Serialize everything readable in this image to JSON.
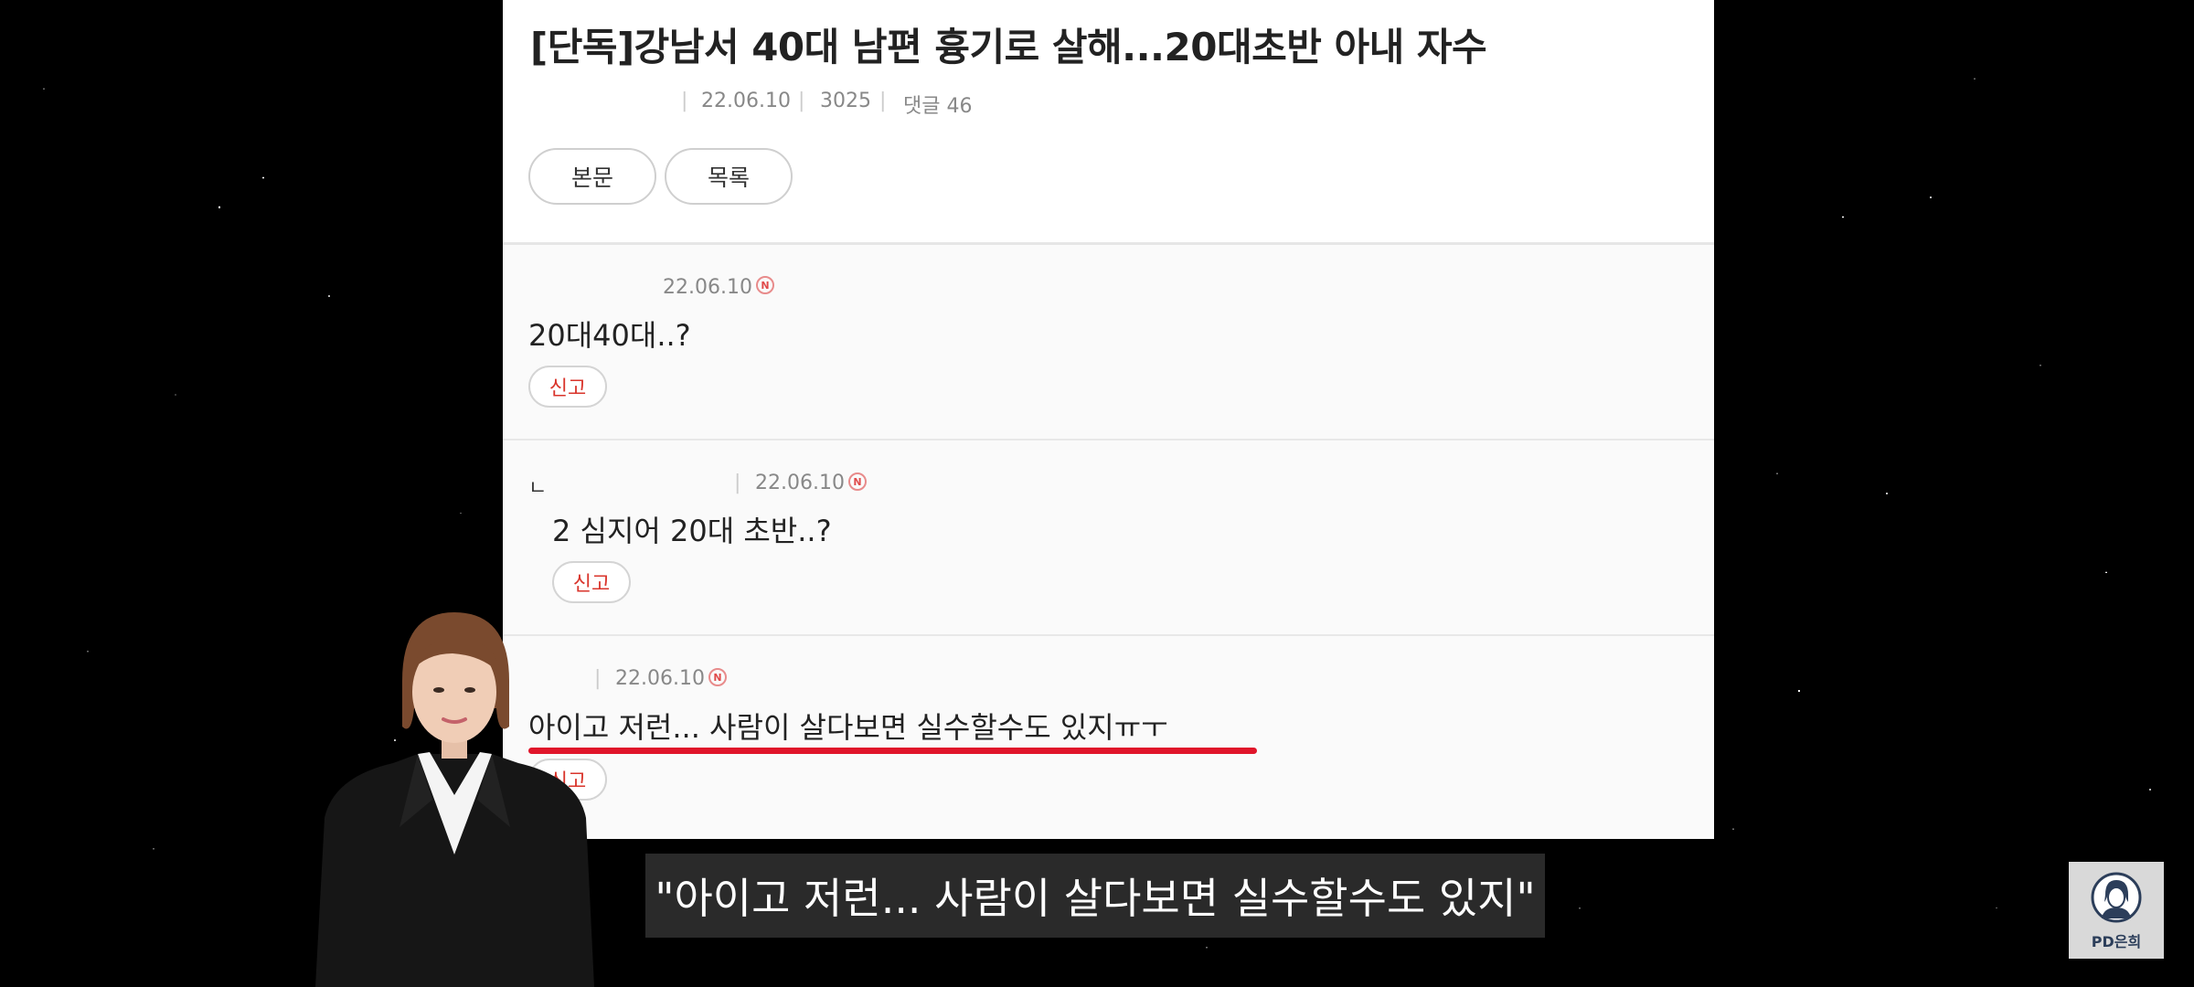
{
  "article": {
    "title": "[단독]강남서 40대 남편 흉기로 살해...20대초반 아내 자수",
    "date": "22.06.10",
    "views": "3025",
    "comments_label": "댓글 46",
    "buttons": {
      "body": "본문",
      "list": "목록"
    }
  },
  "comments": [
    {
      "date": "22.06.10",
      "badge": "N",
      "text": "20대40대..?",
      "report_label": "신고"
    },
    {
      "reply_mark": "ㄴ",
      "date": "22.06.10",
      "badge": "N",
      "text": "2 심지어 20대 초반..?",
      "report_label": "신고"
    },
    {
      "date": "22.06.10",
      "badge": "N",
      "text": "아이고 저런... 사람이 살다보면 실수할수도 있지ㅠㅜ",
      "report_label": "신고"
    }
  ],
  "subtitle": "\"아이고 저런... 사람이 살다보면 실수할수도 있지\"",
  "watermark": {
    "label": "PD은희",
    "icon": "portrait-icon"
  },
  "colors": {
    "highlight_underline": "#e0152a",
    "report_text": "#d9342b",
    "background": "#000000"
  }
}
